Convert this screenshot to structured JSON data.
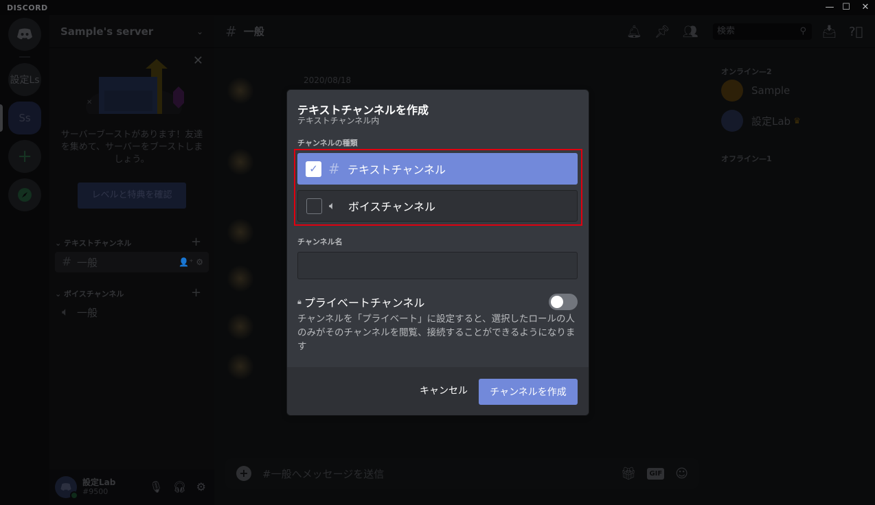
{
  "titlebar": {
    "brand": "DISCORD",
    "minimize": "—",
    "maximize": "☐",
    "close": "✕"
  },
  "rail": {
    "items": [
      {
        "label": "",
        "icon": "discord-home-icon"
      },
      {
        "label": "設定Ls"
      },
      {
        "label": "Ss"
      },
      {
        "label": "+",
        "icon": "add-server-icon"
      },
      {
        "label": "",
        "icon": "compass-icon"
      }
    ]
  },
  "sidebar": {
    "server_name": "Sample's server",
    "boost": {
      "message": "サーバーブーストがあります！友達を集めて、サーバーをブーストしましょう。",
      "button": "レベルと特典を確認"
    },
    "categories": [
      {
        "name": "テキストチャンネル",
        "channels": [
          {
            "name": "一般",
            "type": "text"
          }
        ]
      },
      {
        "name": "ボイスチャンネル",
        "channels": [
          {
            "name": "一般",
            "type": "voice"
          }
        ]
      }
    ],
    "user": {
      "name": "設定Lab",
      "tag": "#9500",
      "status_color": "#43b581"
    }
  },
  "main": {
    "channel_title": "一般",
    "date": "2020/08/18",
    "composer_placeholder": "#一般へメッセージを送信",
    "gif_label": "GIF"
  },
  "topright": {
    "search_placeholder": "検索"
  },
  "members": {
    "online_header": "オンライン—2",
    "offline_header": "オフライン—1",
    "online": [
      {
        "name": "Sample",
        "avatar_color": "#faa61a",
        "status": "idle"
      },
      {
        "name": "設定Lab",
        "avatar_color": "#7289da",
        "status": "online",
        "owner": true
      }
    ]
  },
  "modal": {
    "title": "テキストチャンネルを作成",
    "subtitle": "テキストチャンネル内",
    "type_label": "チャンネルの種類",
    "options": [
      {
        "label": "テキストチャンネル",
        "icon": "hash-icon",
        "checked": true
      },
      {
        "label": "ボイスチャンネル",
        "icon": "speaker-icon",
        "checked": false
      }
    ],
    "name_label": "チャンネル名",
    "name_value": "",
    "private_label": "プライベートチャンネル",
    "private_enabled": false,
    "private_description": "チャンネルを「プライベート」に設定すると、選択したロールの人のみがそのチャンネルを閲覧、接続することができるようになります",
    "cancel_label": "キャンセル",
    "create_label": "チャンネルを作成",
    "colors": {
      "accent": "#7289da",
      "highlight_border": "#e0000f",
      "background": "#36393f",
      "footer": "#2f3136"
    }
  }
}
